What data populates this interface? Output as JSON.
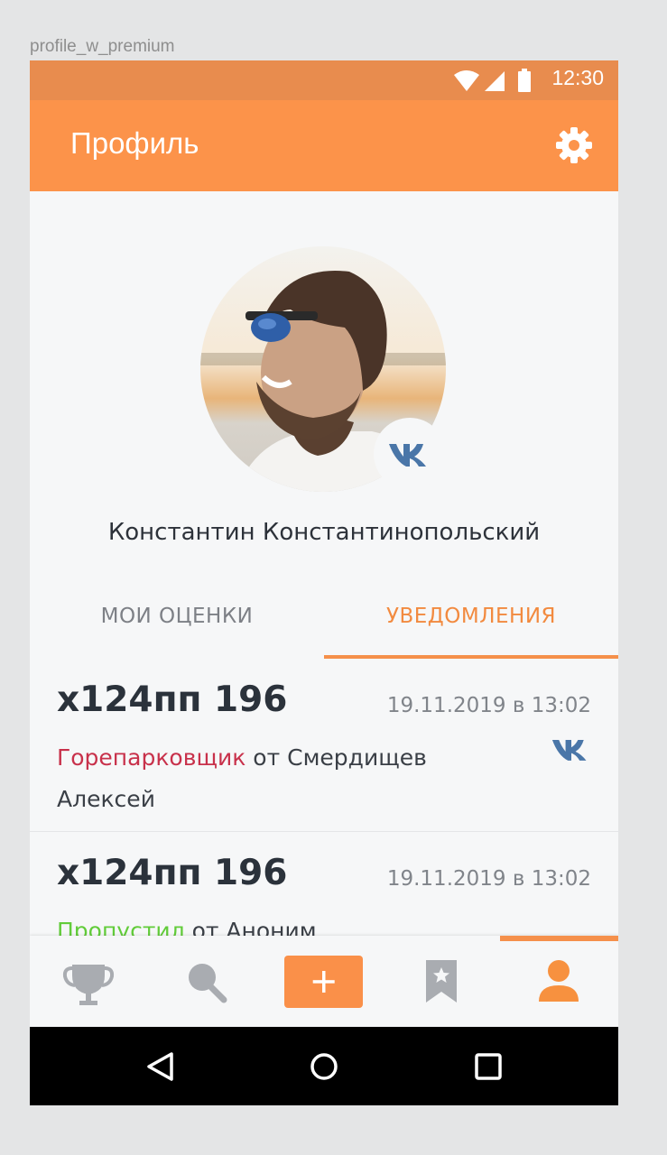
{
  "artboard": {
    "label": "profile_w_premium"
  },
  "status_bar": {
    "time": "12:30"
  },
  "app_bar": {
    "title": "Профиль",
    "settings_icon": "gear-icon"
  },
  "profile": {
    "name": "Константин Константинопольский",
    "social_badge": "vk-icon"
  },
  "tabs": [
    {
      "label": "МОИ ОЦЕНКИ",
      "active": false
    },
    {
      "label": "УВЕДОМЛЕНИЯ",
      "active": true
    }
  ],
  "notifications": [
    {
      "plate": "х124пп 196",
      "date": "19.11.2019 в 13:02",
      "violation": "Горепарковщик",
      "violation_color": "#c8314b",
      "from_text": " от Смердищев Алексей",
      "source_icon": "vk-icon"
    },
    {
      "plate": "х124пп 196",
      "date": "19.11.2019 в 13:02",
      "violation": "Пропустил",
      "violation_color": "#62cc3a",
      "from_text": " от Аноним"
    }
  ],
  "bottom_nav": {
    "items": [
      "trophy-icon",
      "search-icon",
      "add-icon",
      "bookmark-star-icon",
      "profile-icon"
    ],
    "active": "profile-icon"
  },
  "colors": {
    "accent": "#fc934a",
    "status_bar": "#e88c4e",
    "vk_blue": "#4a76a8"
  }
}
